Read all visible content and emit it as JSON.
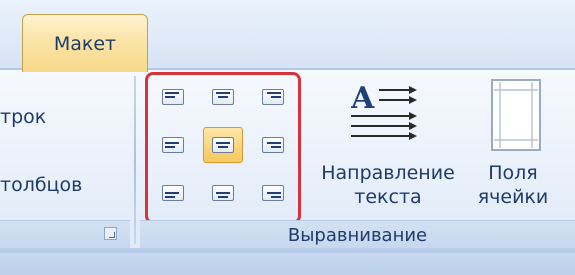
{
  "tabs": {
    "active_label": "Макет"
  },
  "left_group": {
    "row1_label": "трок",
    "row2_label": "толбцов"
  },
  "alignment_group": {
    "title": "Выравнивание",
    "buttons": [
      {
        "id": "top-left",
        "icon": "align-top-left-icon",
        "selected": false
      },
      {
        "id": "top-center",
        "icon": "align-top-center-icon",
        "selected": false
      },
      {
        "id": "top-right",
        "icon": "align-top-right-icon",
        "selected": false
      },
      {
        "id": "middle-left",
        "icon": "align-middle-left-icon",
        "selected": false
      },
      {
        "id": "middle-center",
        "icon": "align-middle-center-icon",
        "selected": true
      },
      {
        "id": "middle-right",
        "icon": "align-middle-right-icon",
        "selected": false
      },
      {
        "id": "bottom-left",
        "icon": "align-bottom-left-icon",
        "selected": false
      },
      {
        "id": "bottom-center",
        "icon": "align-bottom-center-icon",
        "selected": false
      },
      {
        "id": "bottom-right",
        "icon": "align-bottom-right-icon",
        "selected": false
      }
    ],
    "text_direction": {
      "line1": "Направление",
      "line2": "текста",
      "icon_letter": "A"
    },
    "cell_margins": {
      "line1": "Поля",
      "line2": "ячейки"
    }
  },
  "colors": {
    "highlight_border": "#d8323a",
    "selected_fill": "#f8c95c",
    "label_text": "#1e3b6a"
  }
}
